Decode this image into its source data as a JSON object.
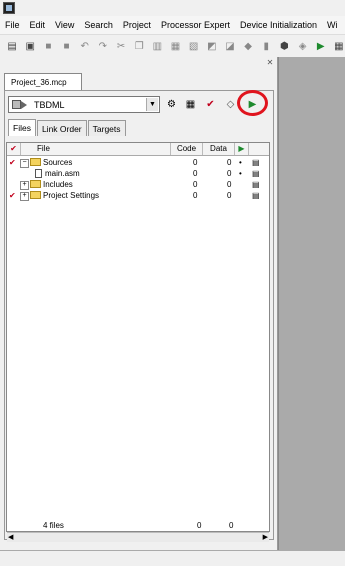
{
  "menu": [
    "File",
    "Edit",
    "View",
    "Search",
    "Project",
    "Processor Expert",
    "Device Initialization",
    "Wi"
  ],
  "project": {
    "tab_title": "Project_36.mcp",
    "target": "TBDML"
  },
  "tabs": [
    "Files",
    "Link Order",
    "Targets"
  ],
  "columns": {
    "file": "File",
    "code": "Code",
    "data": "Data"
  },
  "rows": [
    {
      "name": "Sources",
      "code": "0",
      "data": "0",
      "dot": "•"
    },
    {
      "name": "main.asm",
      "code": "0",
      "data": "0",
      "dot": "•"
    },
    {
      "name": "Includes",
      "code": "0",
      "data": "0",
      "dot": ""
    },
    {
      "name": "Project Settings",
      "code": "0",
      "data": "0",
      "dot": ""
    }
  ],
  "footer": {
    "count": "4 files",
    "code": "0",
    "data": "0"
  },
  "icons": {
    "toolbar": [
      "new-icon",
      "open-icon",
      "save-icon",
      "save-all-icon",
      "undo-icon",
      "redo-icon",
      "cut-icon",
      "copy-icon",
      "paste-icon",
      "compile-icon",
      "make-icon",
      "debug-icon",
      "run-icon"
    ],
    "project_toolbar": [
      "settings-icon",
      "synchronize-icon",
      "check-icon",
      "make-icon",
      "debug-icon"
    ]
  },
  "colors": {
    "highlight": "#e0141e",
    "right_pane": "#aaaaaa",
    "check": "#c0001c"
  }
}
